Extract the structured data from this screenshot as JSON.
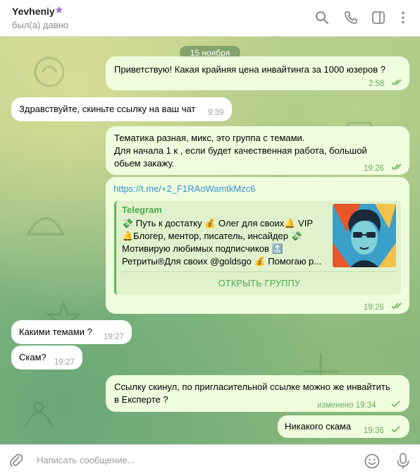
{
  "header": {
    "name": "Yevheniy",
    "status": "был(а) давно",
    "icons": [
      "star-icon",
      "search-icon",
      "phone-icon",
      "sidebar-toggle-icon",
      "more-vertical-icon"
    ]
  },
  "chat": {
    "date_label": "15 ноября",
    "messages": [
      {
        "dir": "out",
        "text": "Приветствую! Какая крайняя цена инвайтинга за 1000 юзеров ?",
        "time": "2:58",
        "status": "read"
      },
      {
        "dir": "in",
        "text": "Здравствуйте, скиньте ссылку на ваш чат",
        "time": "9:39"
      },
      {
        "dir": "out",
        "lines": [
          "Тематика разная, микс, это группа с темами.",
          "Для начала 1 к , если будет качественная работа, большой",
          "обьем закажу."
        ],
        "time": "19:26",
        "status": "read"
      },
      {
        "dir": "out",
        "link": "https://t.me/+2_F1RAoWamtkMzc6",
        "time": "19:26",
        "status": "read",
        "preview": {
          "site": "Telegram",
          "line1": "💸 Путь к достатку 💰 Олег для своих🔔 VIP",
          "line2": "🔔Блогер, ментор, писатель, инсайдер 💸",
          "line3": "Мотивирую любимых подписчиков 🔝",
          "line4": "Ретриты®Для своих @goldsgo 💰 Помогаю р...",
          "button": "ОТКРЫТЬ ГРУППУ"
        }
      },
      {
        "dir": "in",
        "text": "Какими темами ?",
        "time": "19:27"
      },
      {
        "dir": "in",
        "text": "Скам?",
        "time": "19:27"
      },
      {
        "dir": "out",
        "lines": [
          "Ссылку скинул, по пригласительной ссылке можно же инвайтить",
          "в Експерте ?"
        ],
        "time": "изменено 19:34",
        "status": "sent"
      },
      {
        "dir": "out",
        "text": "Никакого скама",
        "time": "19:36",
        "status": "sent"
      }
    ]
  },
  "composer": {
    "placeholder": "Написать сообщение...",
    "icons": [
      "paperclip-icon",
      "emoji-icon",
      "microphone-icon"
    ]
  },
  "colors": {
    "outgoing_bubble": "#effdde",
    "incoming_bubble": "#ffffff",
    "accent_green": "#4fa84a",
    "link_blue": "#3a8fd1"
  }
}
